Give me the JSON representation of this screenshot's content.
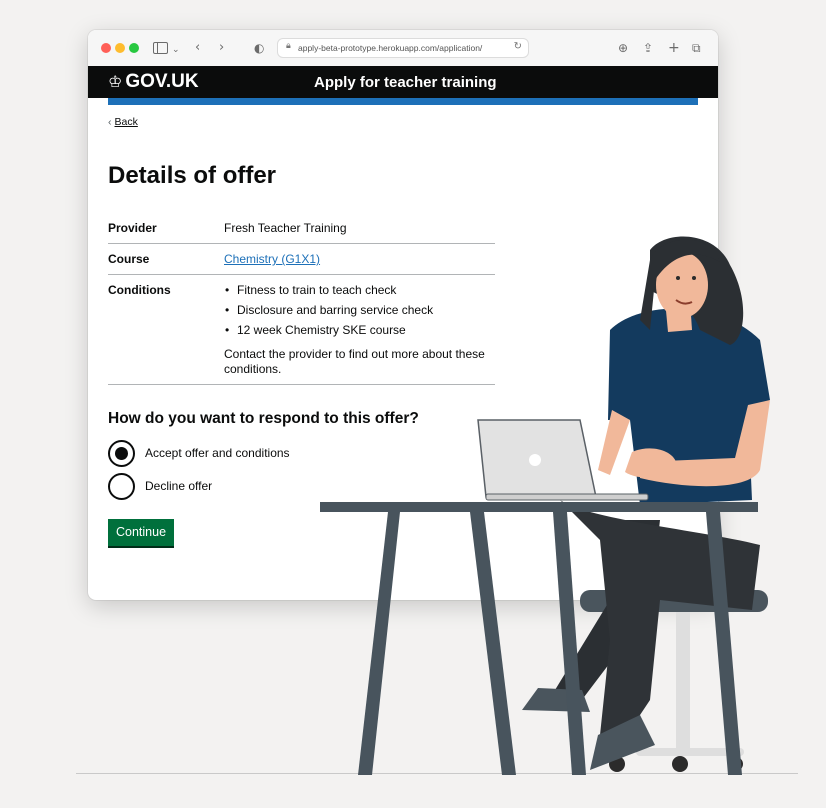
{
  "browser": {
    "url": "apply-beta-prototype.herokuapp.com/application/"
  },
  "header": {
    "logo_text": "GOV.UK",
    "service_name": "Apply for teacher training"
  },
  "back_link": "Back",
  "page_title": "Details of offer",
  "summary": {
    "provider_key": "Provider",
    "provider_value": "Fresh Teacher Training",
    "course_key": "Course",
    "course_value": "Chemistry (G1X1)",
    "conditions_key": "Conditions",
    "conditions": [
      "Fitness to train to teach check",
      "Disclosure and barring service check",
      "12 week Chemistry SKE course"
    ],
    "conditions_note": "Contact the provider to find out more about these conditions."
  },
  "response": {
    "question": "How do you want to respond to this offer?",
    "options": [
      {
        "label": "Accept offer and conditions",
        "selected": true
      },
      {
        "label": "Decline offer",
        "selected": false
      }
    ],
    "continue_label": "Continue"
  },
  "colors": {
    "gov_black": "#0b0c0c",
    "gov_blue": "#1d70b8",
    "button_green": "#00703c",
    "shirt_navy": "#133a5e",
    "desk_grey": "#48545d"
  },
  "icons": [
    "crown-icon",
    "padlock-icon",
    "reload-icon",
    "download-icon",
    "share-icon",
    "new-tab-icon",
    "tab-overview-icon"
  ]
}
